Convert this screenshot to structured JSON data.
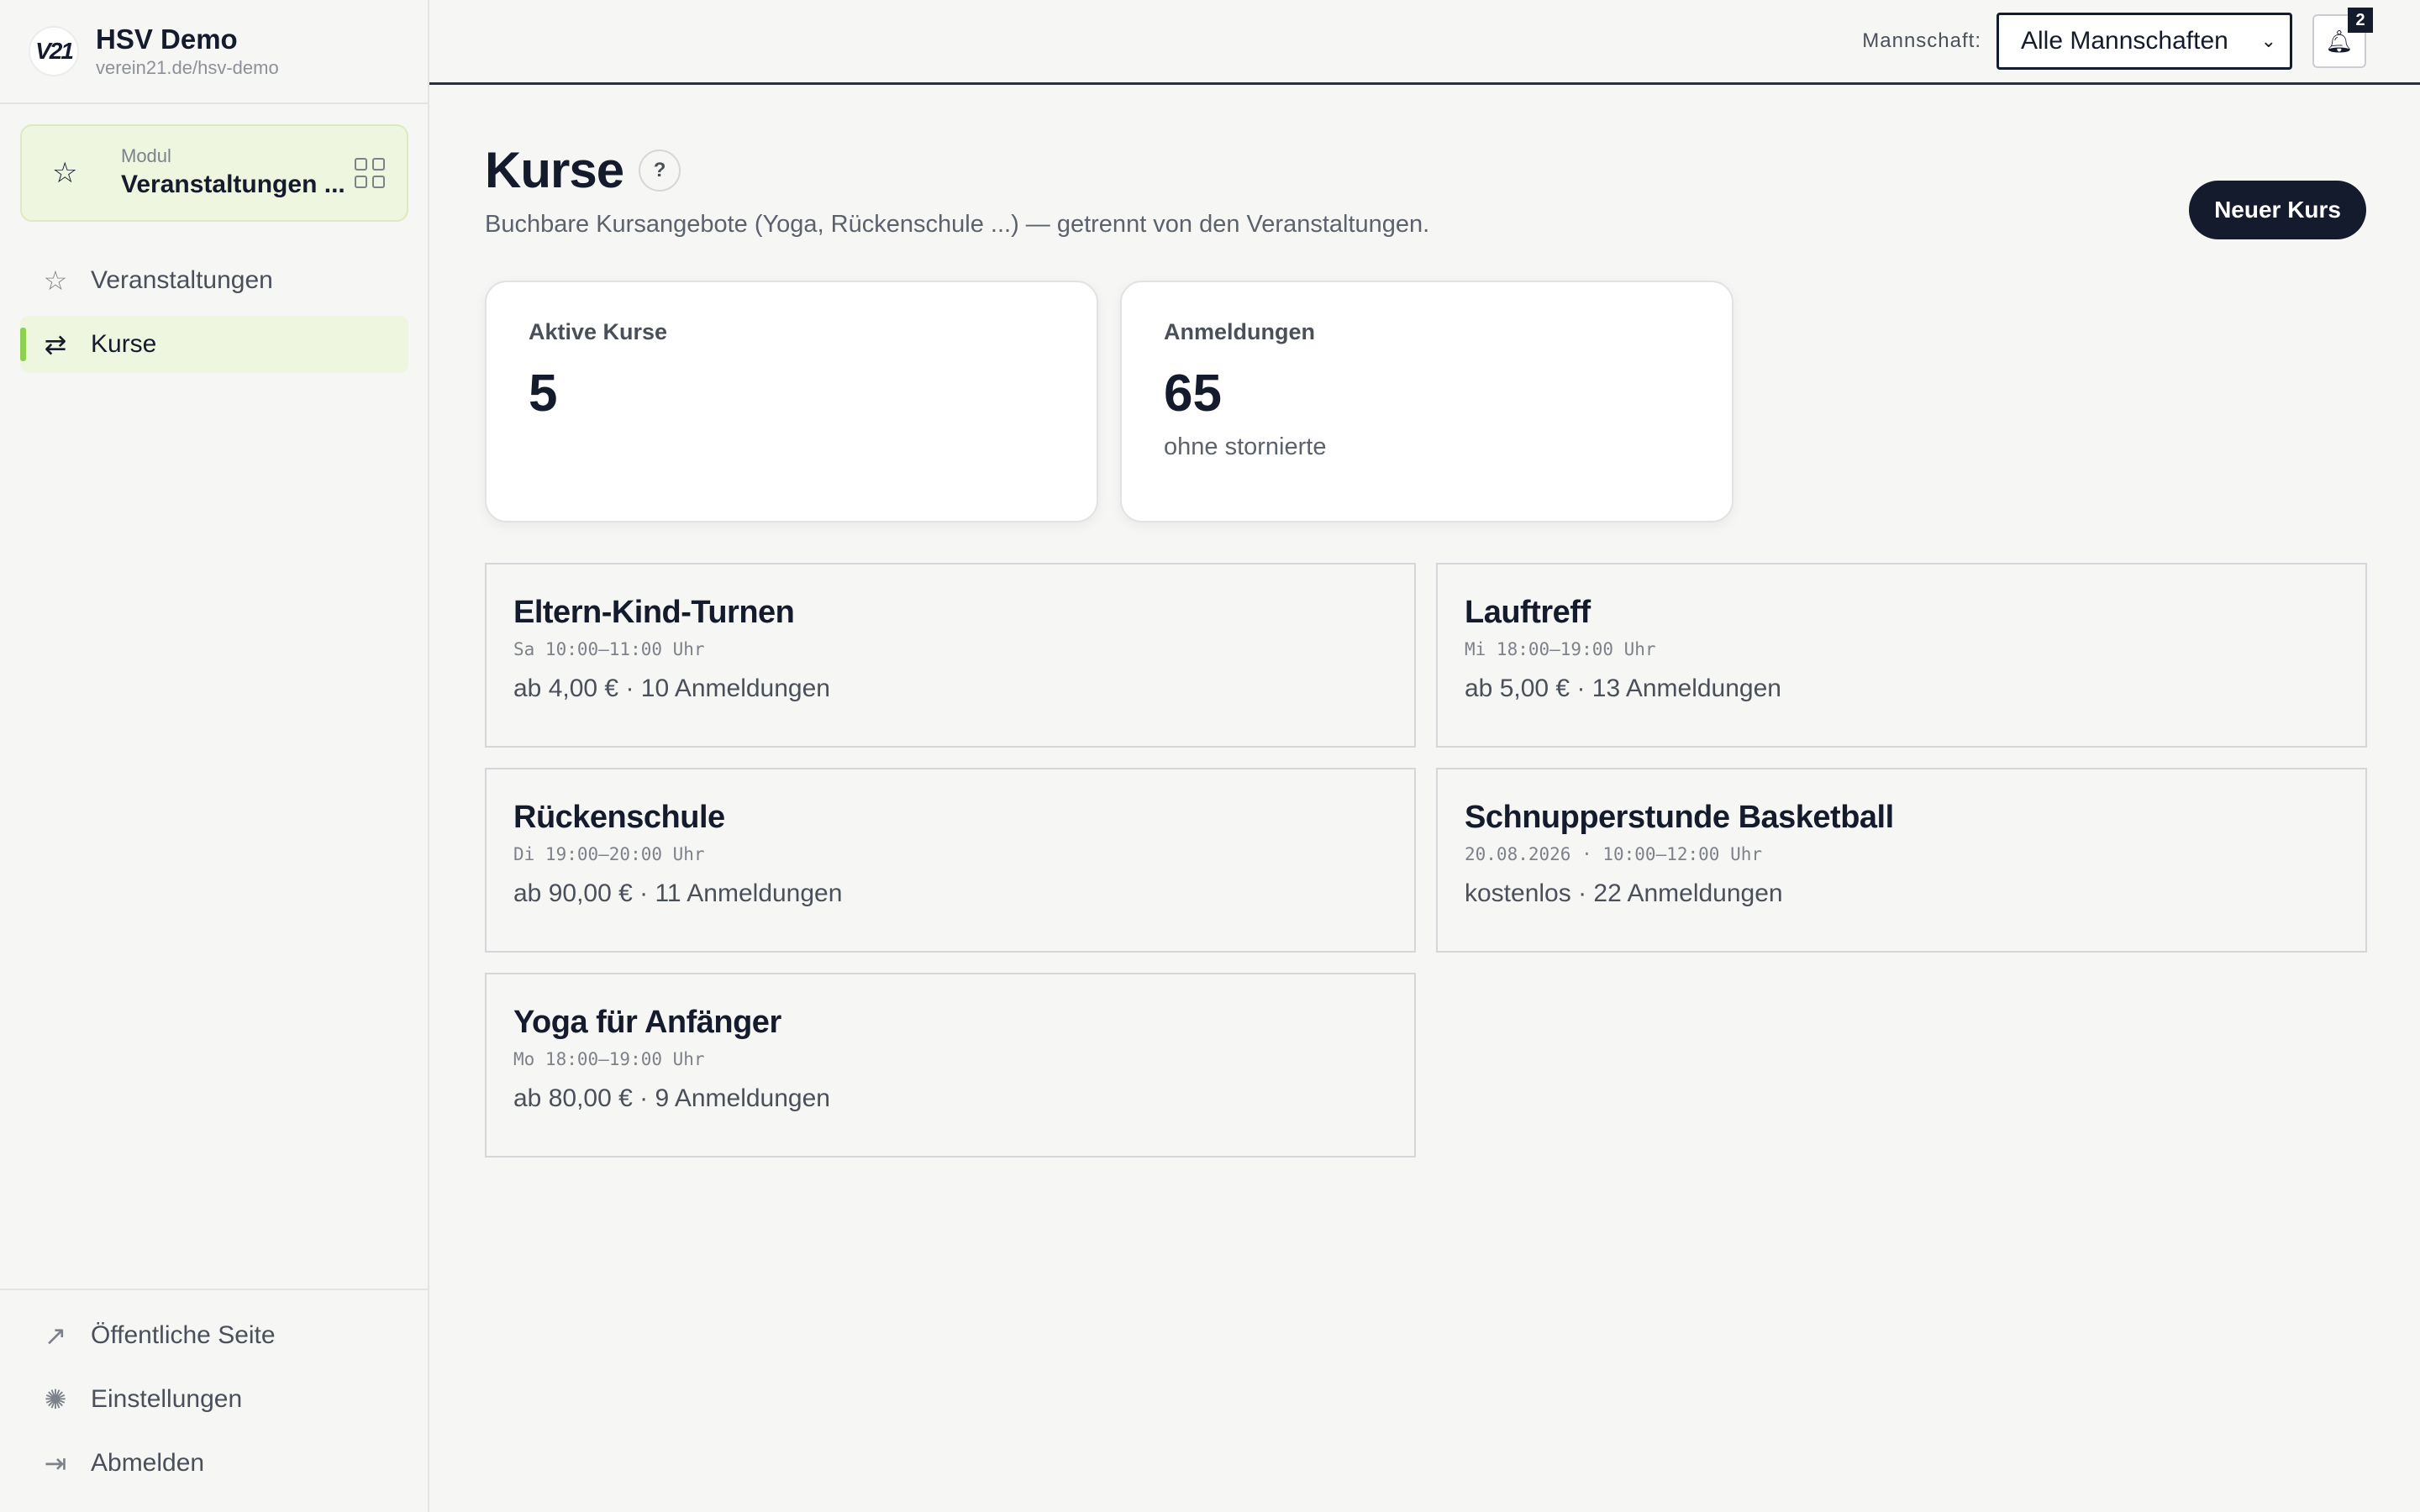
{
  "brand": {
    "logo_text": "V21",
    "name": "HSV Demo",
    "url": "verein21.de/hsv-demo"
  },
  "module": {
    "label": "Modul",
    "value": "Veranstaltungen ..."
  },
  "sidebar": {
    "items": [
      {
        "label": "Veranstaltungen",
        "icon": "star-icon",
        "active": false
      },
      {
        "label": "Kurse",
        "icon": "repeat-icon",
        "active": true
      }
    ],
    "bottom_items": [
      {
        "label": "Öffentliche Seite",
        "icon": "external-link-icon"
      },
      {
        "label": "Einstellungen",
        "icon": "gear-icon"
      },
      {
        "label": "Abmelden",
        "icon": "logout-icon"
      }
    ]
  },
  "topbar": {
    "team_label": "Mannschaft:",
    "team_selected": "Alle Mannschaften",
    "notification_count": "2"
  },
  "page": {
    "title": "Kurse",
    "help": "?",
    "subtitle": "Buchbare Kursangebote (Yoga, Rückenschule ...) — getrennt von den Veranstaltungen.",
    "new_button": "Neuer Kurs"
  },
  "stats": [
    {
      "label": "Aktive Kurse",
      "value": "5",
      "note": ""
    },
    {
      "label": "Anmeldungen",
      "value": "65",
      "note": "ohne stornierte"
    }
  ],
  "courses": [
    {
      "name": "Eltern-Kind-Turnen",
      "time": "Sa 10:00–11:00 Uhr",
      "meta": "ab 4,00 € · 10 Anmeldungen"
    },
    {
      "name": "Lauftreff",
      "time": "Mi 18:00–19:00 Uhr",
      "meta": "ab 5,00 € · 13 Anmeldungen"
    },
    {
      "name": "Rückenschule",
      "time": "Di 19:00–20:00 Uhr",
      "meta": "ab 90,00 € · 11 Anmeldungen"
    },
    {
      "name": "Schnupperstunde Basketball",
      "time": "20.08.2026 · 10:00–12:00 Uhr",
      "meta": "kostenlos · 22 Anmeldungen"
    },
    {
      "name": "Yoga für Anfänger",
      "time": "Mo 18:00–19:00 Uhr",
      "meta": "ab 80,00 € · 9 Anmeldungen"
    }
  ],
  "colors": {
    "accent": "#8fd14f",
    "accent_bg": "#eef6df",
    "dark": "#141b2d",
    "background": "#f6f6f4"
  }
}
